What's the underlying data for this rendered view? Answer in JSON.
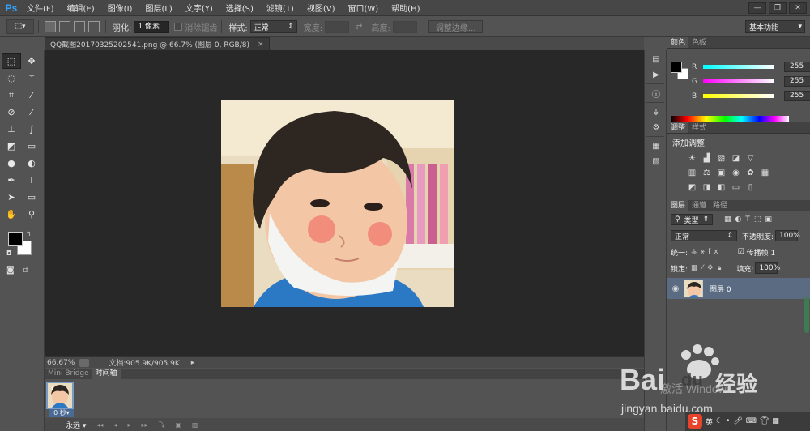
{
  "app": {
    "logo": "Ps"
  },
  "menu": [
    "文件(F)",
    "编辑(E)",
    "图像(I)",
    "图层(L)",
    "文字(Y)",
    "选择(S)",
    "滤镜(T)",
    "视图(V)",
    "窗口(W)",
    "帮助(H)"
  ],
  "window_controls": {
    "minimize": "—",
    "restore": "❐",
    "close": "✕"
  },
  "options": {
    "feather_label": "羽化:",
    "feather_value": "1 像素",
    "antialias_label": "消除锯齿",
    "style_label": "样式:",
    "style_value": "正常",
    "width_label": "宽度:",
    "height_label": "高度:",
    "refine_button": "调整边缘...",
    "workspace": "基本功能"
  },
  "document": {
    "tab_title": "QQ截图20170325202541.png @ 66.7% (图层 0, RGB/8)",
    "tab_close": "×",
    "zoom": "66.67%",
    "doc_info": "文档:905.9K/905.9K"
  },
  "bottom": {
    "tabs": [
      "Mini Bridge",
      "时间轴"
    ],
    "frame_number": "1",
    "frame_time": "0 秒▾",
    "loop": "永远 ▾"
  },
  "color_panel": {
    "tabs": [
      "颜色",
      "色板"
    ],
    "r_label": "R",
    "r_value": "255",
    "g_label": "G",
    "g_value": "255",
    "b_label": "B",
    "b_value": "255"
  },
  "adjust_panel": {
    "tabs": [
      "调整",
      "样式"
    ],
    "title": "添加调整"
  },
  "layers_panel": {
    "tabs": [
      "图层",
      "通道",
      "路径"
    ],
    "filter_value": "类型",
    "blend_mode": "正常",
    "opacity_label": "不透明度:",
    "opacity_value": "100%",
    "unify_label": "统一:",
    "propagate_label": "传播帧 1",
    "lock_label": "锁定:",
    "fill_label": "填充:",
    "fill_value": "100%",
    "layer_name": "图层 0"
  },
  "watermark": {
    "brand": "Bai",
    "brand2": "du",
    "brand_cn": "经验",
    "url": "jingyan.baidu.com",
    "activate": "激活 Windows"
  },
  "taskbar": {
    "s": "S",
    "lang": "英"
  }
}
